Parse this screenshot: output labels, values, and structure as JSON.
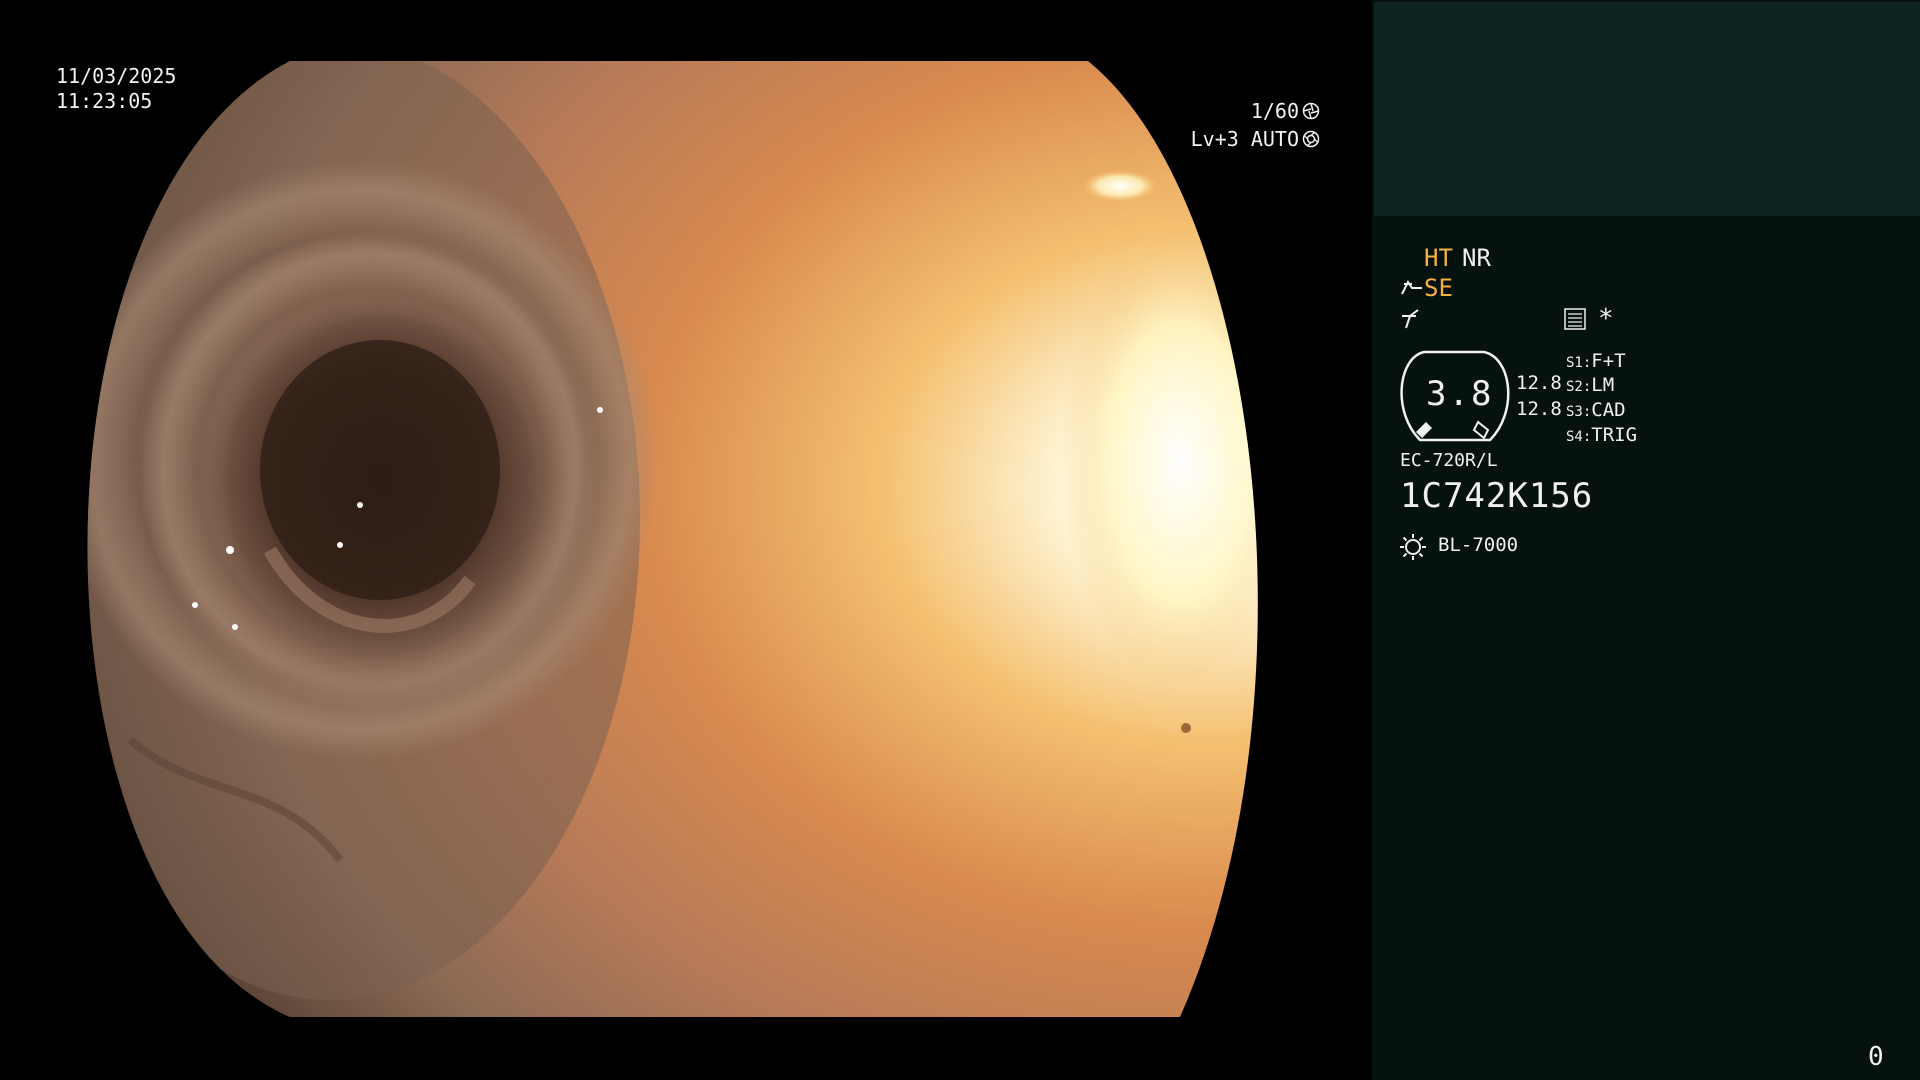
{
  "image_overlay": {
    "date": "11/03/2025",
    "time": "11:23:05",
    "shutter": "1/60",
    "shutter_icon": "shutter-icon",
    "level": "Lv+3 AUTO",
    "auto_icon": "iris-icon"
  },
  "panel": {
    "mode_ht": "HT",
    "mode_nr": "NR",
    "mode_se": "SE",
    "se_icon": "structure-enhance-icon",
    "sharp_icon": "sharpness-icon",
    "menu_icon": "menu-list-icon",
    "star": "*",
    "gauge": {
      "value": "3.8",
      "top_value": "12.8",
      "bottom_value": "12.8"
    },
    "slots": [
      {
        "key": "S1:",
        "value": "F+T"
      },
      {
        "key": "S2:",
        "value": "LM"
      },
      {
        "key": "S3:",
        "value": "CAD"
      },
      {
        "key": "S4:",
        "value": "TRIG"
      }
    ],
    "scope_model": "EC-720R/L",
    "scope_serial": "1C742K156",
    "light_icon": "light-source-icon",
    "light_source": "BL-7000",
    "counter": "0"
  },
  "colors": {
    "panel_bg": "#051210",
    "thumb_bg": "#0e2423",
    "accent_orange": "#f5b041",
    "text": "#f0f0f0"
  }
}
